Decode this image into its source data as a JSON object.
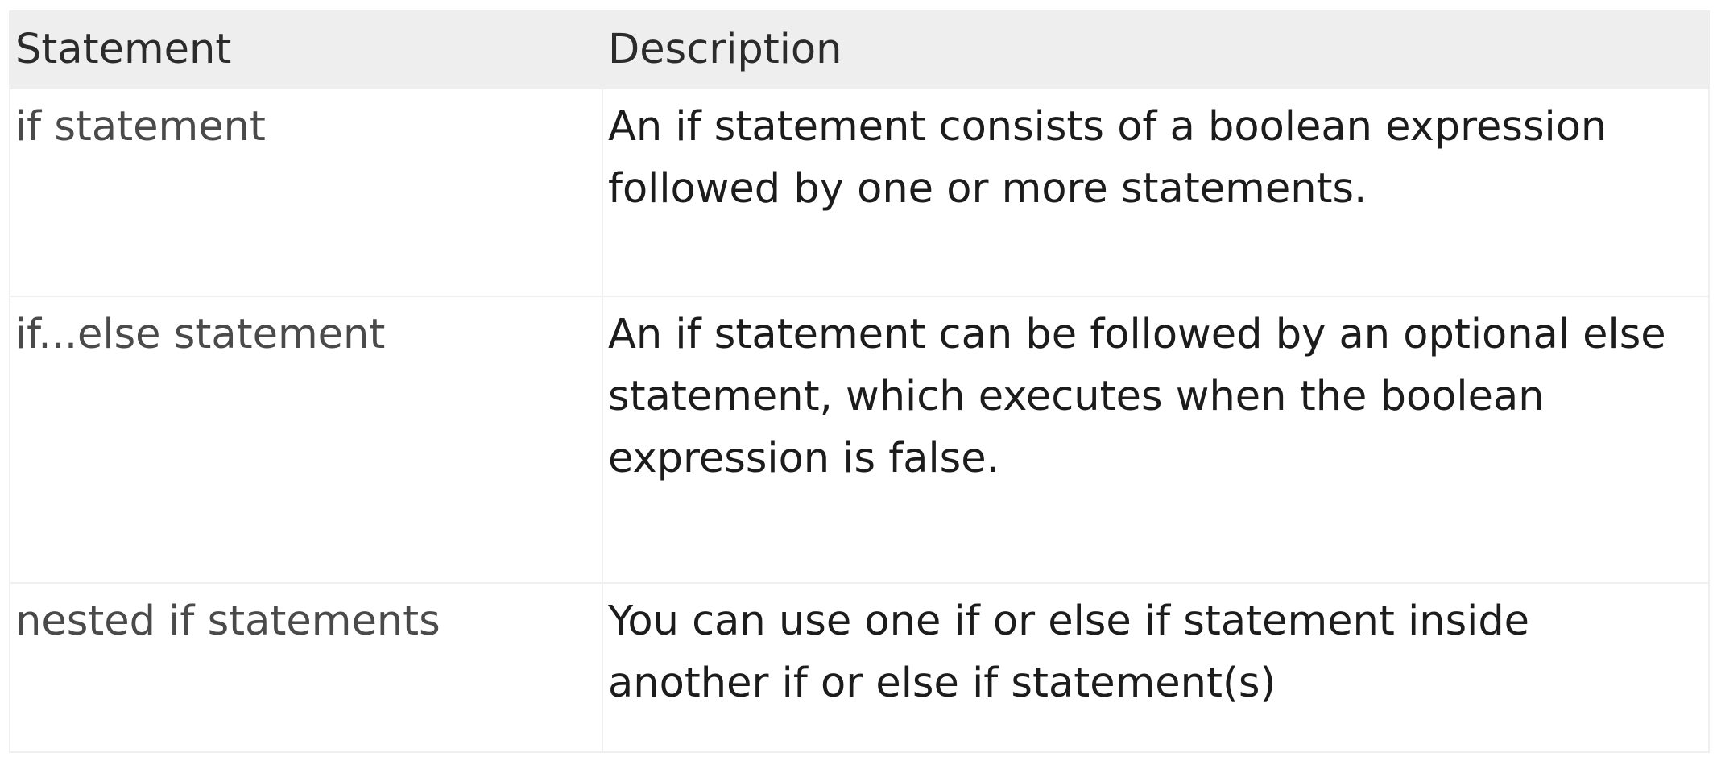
{
  "table": {
    "headers": [
      "Statement",
      "Description"
    ],
    "rows": [
      {
        "statement": "if statement",
        "description": "An if statement consists of a boolean expression followed by one or more statements."
      },
      {
        "statement": "if...else statement",
        "description": "An if statement can be followed by an optional else statement, which executes when the boolean expression is false."
      },
      {
        "statement": "nested if statements",
        "description": "You can use one if or else if statement inside another if or else if statement(s)"
      }
    ]
  },
  "colors": {
    "header_background": "#eeeeee",
    "border": "#efefef",
    "text": "#1c1c1c"
  }
}
